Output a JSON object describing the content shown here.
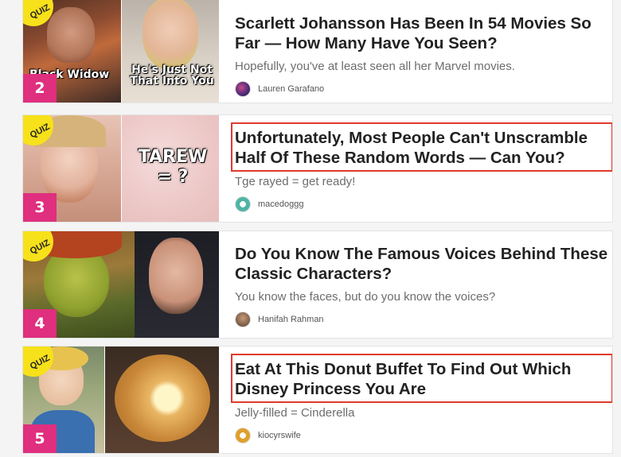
{
  "quiz_badge_label": "QUIZ",
  "accent_colors": {
    "rank_badge": "#df2f7e",
    "quiz_badge": "#f7e11a",
    "highlight_box": "#e03a2c"
  },
  "items": [
    {
      "rank": "2",
      "title": "Scarlett Johansson Has Been In 54 Movies So Far — How Many Have You Seen?",
      "description": "Hopefully, you've at least seen all her Marvel movies.",
      "author": "Lauren Garafano",
      "thumb_caption_left": "Black Widow",
      "thumb_caption_right": "He's Just Not That Into You",
      "highlighted": false
    },
    {
      "rank": "3",
      "title": "Unfortunately, Most People Can't Unscramble Half Of These Random Words — Can You?",
      "description": "Tge rayed = get ready!",
      "author": "macedoggg",
      "thumb_caption_right": "TAREW = ?",
      "highlighted": true
    },
    {
      "rank": "4",
      "title": "Do You Know The Famous Voices Behind These Classic Characters?",
      "description": "You know the faces, but do you know the voices?",
      "author": "Hanifah Rahman",
      "highlighted": false
    },
    {
      "rank": "5",
      "title": "Eat At This Donut Buffet To Find Out Which Disney Princess You Are",
      "description": "Jelly-filled = Cinderella",
      "author": "kiocyrswife",
      "highlighted": true
    }
  ]
}
